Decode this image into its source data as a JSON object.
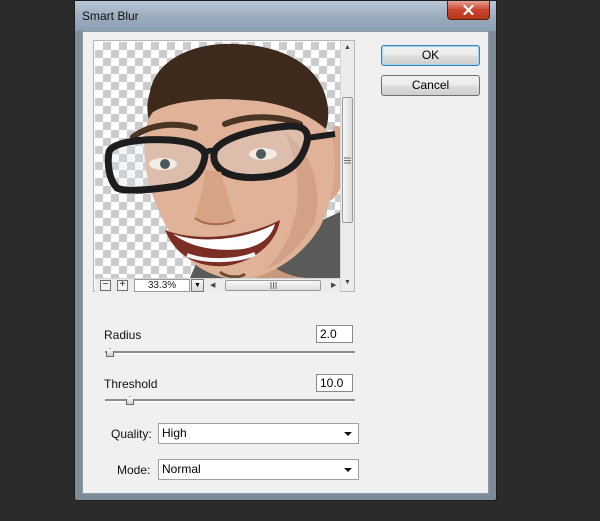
{
  "window": {
    "title": "Smart Blur"
  },
  "buttons": {
    "ok_label": "OK",
    "cancel_label": "Cancel"
  },
  "preview": {
    "zoom": "33.3%"
  },
  "radius": {
    "label": "Radius",
    "value": "2.0",
    "slider_position": 0.02
  },
  "threshold": {
    "label": "Threshold",
    "value": "10.0",
    "slider_position": 0.1
  },
  "quality": {
    "label": "Quality:",
    "selected": "High"
  },
  "mode": {
    "label": "Mode:",
    "selected": "Normal"
  },
  "colors": {
    "default_button_border": "#3c7fb1",
    "close_button": "#c8452e",
    "titlebar": "#9aabbd"
  }
}
